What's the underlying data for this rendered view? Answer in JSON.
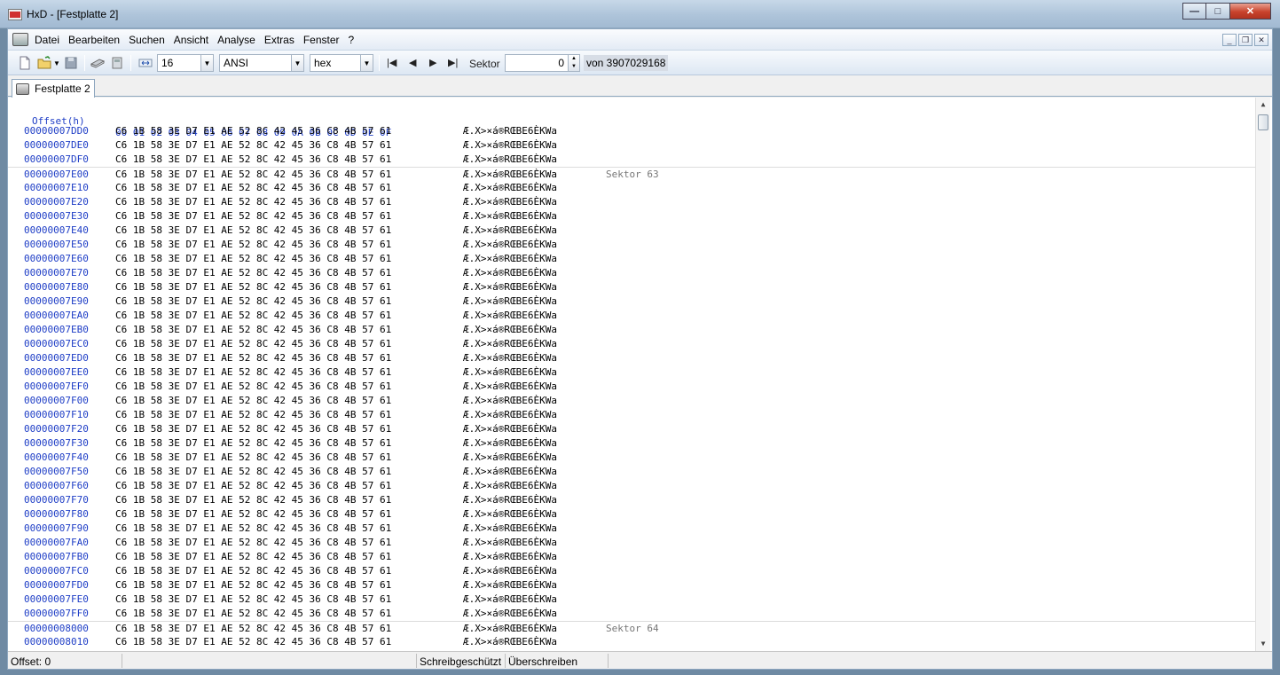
{
  "window": {
    "title": "HxD - [Festplatte 2]",
    "controls": {
      "minimize": "—",
      "maximize": "□",
      "close": "✕"
    }
  },
  "menu": {
    "items": [
      "Datei",
      "Bearbeiten",
      "Suchen",
      "Ansicht",
      "Analyse",
      "Extras",
      "Fenster",
      "?"
    ]
  },
  "toolbar": {
    "bytes_per_row": "16",
    "charset": "ANSI",
    "offset_base": "hex",
    "sector_label": "Sektor",
    "sector_value": "0",
    "sector_total": "von 3907029168"
  },
  "tabs": [
    {
      "label": "Festplatte 2"
    }
  ],
  "hexview": {
    "header_offset": "Offset(h)",
    "header_columns": "00 01 02 03 04 05 06 07 08 09 0A 0B 0C 0D 0E 0F",
    "row_hex": "C6 1B 58 3E D7 E1 AE 52 8C 42 45 36 C8 4B 57 61",
    "row_text": "Æ.X>×á®RŒBE6ÈKWa",
    "rows": [
      {
        "offset": "00000007DD0"
      },
      {
        "offset": "00000007DE0"
      },
      {
        "offset": "00000007DF0"
      },
      {
        "offset": "00000007E00",
        "sector": "Sektor 63"
      },
      {
        "offset": "00000007E10"
      },
      {
        "offset": "00000007E20"
      },
      {
        "offset": "00000007E30"
      },
      {
        "offset": "00000007E40"
      },
      {
        "offset": "00000007E50"
      },
      {
        "offset": "00000007E60"
      },
      {
        "offset": "00000007E70"
      },
      {
        "offset": "00000007E80"
      },
      {
        "offset": "00000007E90"
      },
      {
        "offset": "00000007EA0"
      },
      {
        "offset": "00000007EB0"
      },
      {
        "offset": "00000007EC0"
      },
      {
        "offset": "00000007ED0"
      },
      {
        "offset": "00000007EE0"
      },
      {
        "offset": "00000007EF0"
      },
      {
        "offset": "00000007F00"
      },
      {
        "offset": "00000007F10"
      },
      {
        "offset": "00000007F20"
      },
      {
        "offset": "00000007F30"
      },
      {
        "offset": "00000007F40"
      },
      {
        "offset": "00000007F50"
      },
      {
        "offset": "00000007F60"
      },
      {
        "offset": "00000007F70"
      },
      {
        "offset": "00000007F80"
      },
      {
        "offset": "00000007F90"
      },
      {
        "offset": "00000007FA0"
      },
      {
        "offset": "00000007FB0"
      },
      {
        "offset": "00000007FC0"
      },
      {
        "offset": "00000007FD0"
      },
      {
        "offset": "00000007FE0"
      },
      {
        "offset": "00000007FF0"
      },
      {
        "offset": "00000008000",
        "sector": "Sektor 64"
      },
      {
        "offset": "00000008010"
      }
    ]
  },
  "status": {
    "offset": "Offset: 0",
    "write_protection": "Schreibgeschützt",
    "mode": "Überschreiben"
  }
}
